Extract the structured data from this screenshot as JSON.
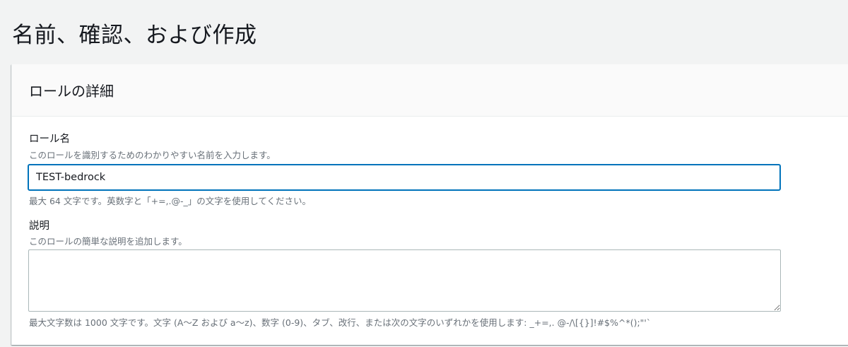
{
  "page": {
    "title": "名前、確認、および作成"
  },
  "role_details": {
    "heading": "ロールの詳細",
    "role_name": {
      "label": "ロール名",
      "description": "このロールを識別するためのわかりやすい名前を入力します。",
      "value": "TEST-bedrock",
      "constraint": "最大 64 文字です。英数字と「+=,.@-_」の文字を使用してください。"
    },
    "description": {
      "label": "説明",
      "description": "このロールの簡単な説明を追加します。",
      "value": "",
      "constraint": "最大文字数は 1000 文字です。文字 (A〜Z および a〜z)、数字 (0-9)、タブ、改行、または次の文字のいずれかを使用します: _+=,. @-/\\[{}]!#$%^*();\"'`"
    }
  },
  "colors": {
    "focus_border": "#0073bb",
    "page_background": "#f2f3f3",
    "secondary_text": "#687078"
  }
}
